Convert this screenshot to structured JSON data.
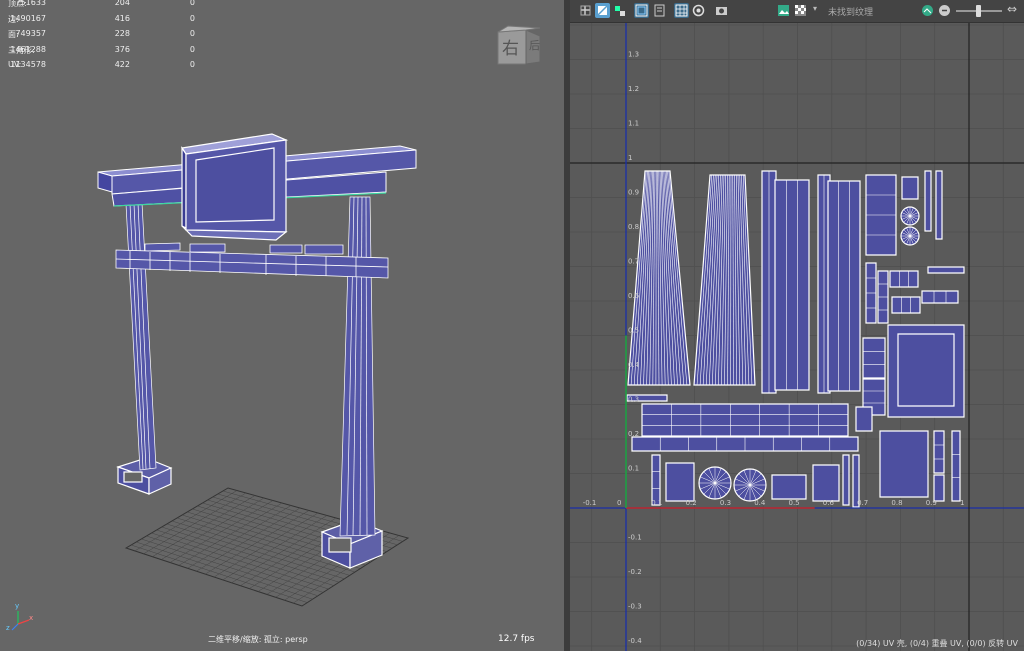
{
  "viewport": {
    "stats": [
      {
        "label": "顶点:",
        "v1": "751633",
        "v2": "204",
        "v3": "0"
      },
      {
        "label": "边:",
        "v1": "1490167",
        "v2": "416",
        "v3": "0"
      },
      {
        "label": "面:",
        "v1": "749357",
        "v2": "228",
        "v3": "0"
      },
      {
        "label": "三角形:",
        "v1": "1461288",
        "v2": "376",
        "v3": "0"
      },
      {
        "label": "UV:",
        "v1": "1134578",
        "v2": "422",
        "v3": "0"
      }
    ],
    "viewcube_right": "右",
    "viewcube_side": "后",
    "status": "二维平移/缩放: 孤立: persp",
    "fps": "12.7 fps",
    "axis_x": "x",
    "axis_y": "y",
    "axis_z": "z"
  },
  "uv_editor": {
    "texture_label": "未找到纹理",
    "status": "(0/34) UV 壳, (0/4) 重叠 UV, (0/0) 反转 UV",
    "u_ticks": [
      "-0.1",
      "0",
      "0.1",
      "0.2",
      "0.3",
      "0.4",
      "0.5",
      "0.6",
      "0.7",
      "0.8",
      "0.9",
      "1"
    ],
    "v_ticks": [
      "1.3",
      "1.2",
      "1.1",
      "1",
      "0.9",
      "0.8",
      "0.7",
      "0.6",
      "0.5",
      "0.4",
      "0.3",
      "0.2",
      "0.1",
      "0",
      "-0.1",
      "-0.2",
      "-0.3",
      "-0.4"
    ]
  },
  "colors": {
    "viewport_bg": "#666666",
    "uv_bg": "#5a5a5a",
    "shell_fill": "#4d4fa0",
    "wire": "#ffffff",
    "u_axis": "#1a2fa8",
    "v_axis": "#1a2fa8",
    "accent_green": "#3bd6a0"
  }
}
